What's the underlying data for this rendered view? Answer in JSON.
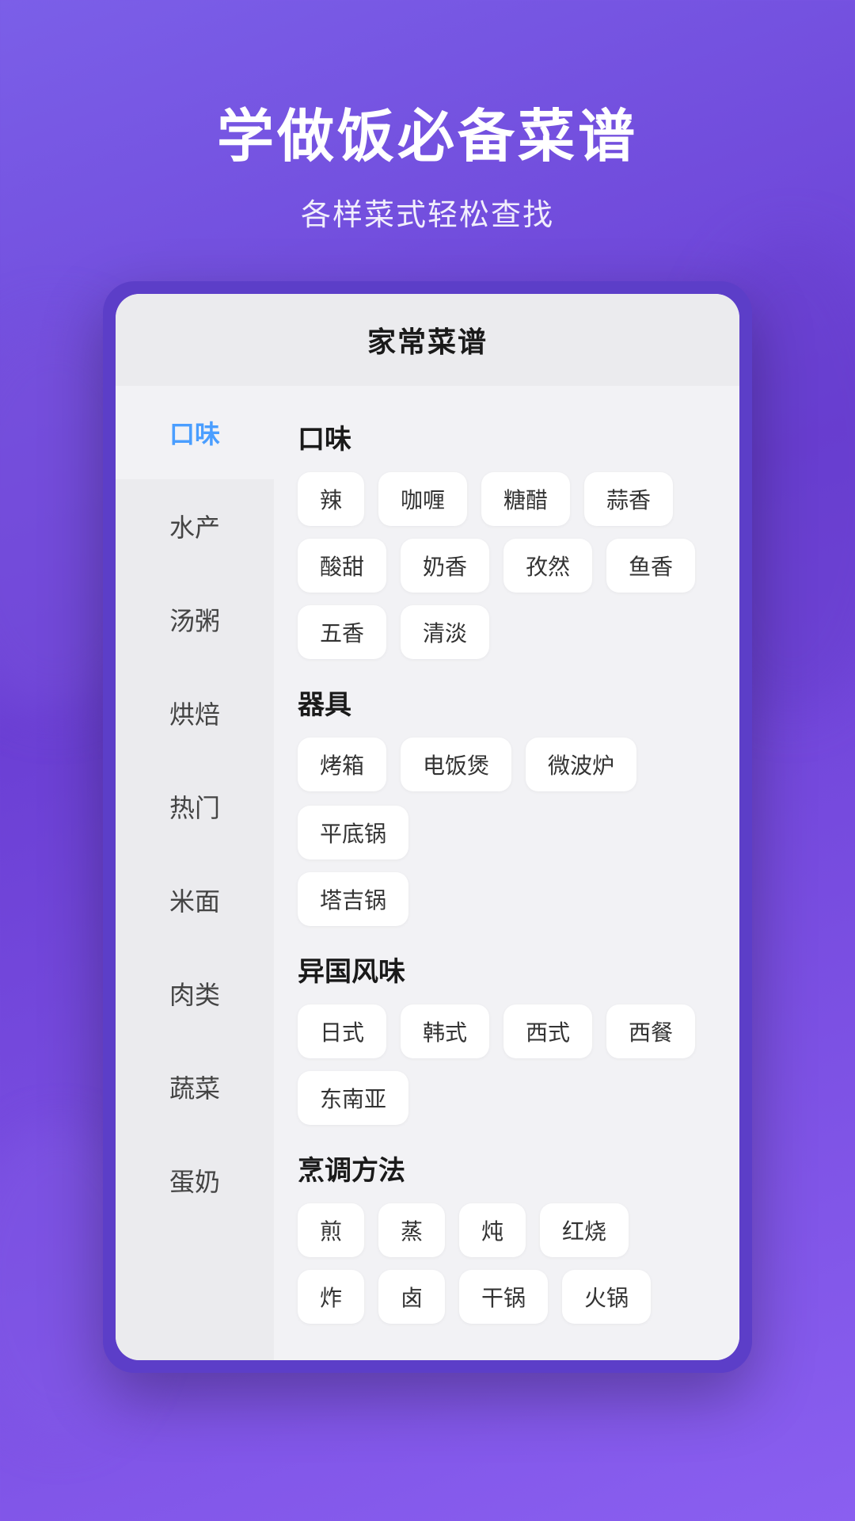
{
  "header": {
    "title": "学做饭必备菜谱",
    "subtitle": "各样菜式轻松查找"
  },
  "card": {
    "title": "家常菜谱"
  },
  "sidebar": {
    "items": [
      {
        "id": "kouwei",
        "label": "口味",
        "active": true
      },
      {
        "id": "shuichan",
        "label": "水产",
        "active": false
      },
      {
        "id": "tangzhou",
        "label": "汤粥",
        "active": false
      },
      {
        "id": "hongbei",
        "label": "烘焙",
        "active": false
      },
      {
        "id": "remen",
        "label": "热门",
        "active": false
      },
      {
        "id": "mimian",
        "label": "米面",
        "active": false
      },
      {
        "id": "roulei",
        "label": "肉类",
        "active": false
      },
      {
        "id": "shucai",
        "label": "蔬菜",
        "active": false
      },
      {
        "id": "dannu",
        "label": "蛋奶",
        "active": false
      }
    ]
  },
  "sections": [
    {
      "id": "kouwei",
      "title": "口味",
      "rows": [
        [
          "辣",
          "咖喱",
          "糖醋",
          "蒜香"
        ],
        [
          "酸甜",
          "奶香",
          "孜然",
          "鱼香"
        ],
        [
          "五香",
          "清淡"
        ]
      ]
    },
    {
      "id": "qiju",
      "title": "器具",
      "rows": [
        [
          "烤箱",
          "电饭煲",
          "微波炉",
          "平底锅"
        ],
        [
          "塔吉锅"
        ]
      ]
    },
    {
      "id": "yiguofengwei",
      "title": "异国风味",
      "rows": [
        [
          "日式",
          "韩式",
          "西式",
          "西餐"
        ],
        [
          "东南亚"
        ]
      ]
    },
    {
      "id": "pengtiao",
      "title": "烹调方法",
      "rows": [
        [
          "煎",
          "蒸",
          "炖",
          "红烧"
        ],
        [
          "炸",
          "卤",
          "干锅",
          "火锅"
        ]
      ]
    }
  ]
}
